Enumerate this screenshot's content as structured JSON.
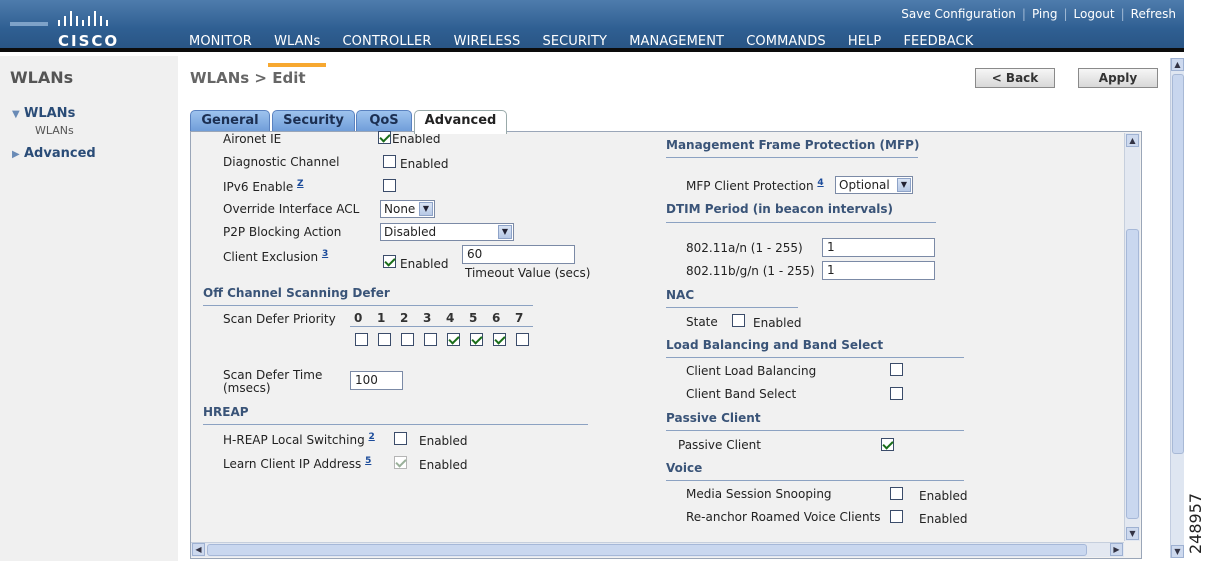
{
  "brand": {
    "logo_text": "CISCO"
  },
  "top_links": [
    "Save Configuration",
    "Ping",
    "Logout",
    "Refresh"
  ],
  "main_nav": [
    "MONITOR",
    "WLANs",
    "CONTROLLER",
    "WIRELESS",
    "SECURITY",
    "MANAGEMENT",
    "COMMANDS",
    "HELP",
    "FEEDBACK"
  ],
  "main_nav_active": "WLANs",
  "sidebar": {
    "title": "WLANs",
    "nodes": [
      {
        "label": "WLANs",
        "expanded": true,
        "children": [
          "WLANs"
        ]
      },
      {
        "label": "Advanced",
        "expanded": false
      }
    ]
  },
  "page": {
    "title": "WLANs > Edit",
    "back_label": "< Back",
    "apply_label": "Apply"
  },
  "tabs": [
    "General",
    "Security",
    "QoS",
    "Advanced"
  ],
  "active_tab": "Advanced",
  "left": {
    "aironet_ie": {
      "label": "Aironet IE",
      "checked": true,
      "text": "Enabled"
    },
    "diagnostic_channel": {
      "label": "Diagnostic Channel",
      "checked": false,
      "text": "Enabled"
    },
    "ipv6_enable": {
      "label": "IPv6 Enable",
      "footnote": "Z",
      "checked": false
    },
    "override_acl": {
      "label": "Override Interface ACL",
      "value": "None"
    },
    "p2p_blocking": {
      "label": "P2P Blocking Action",
      "value": "Disabled"
    },
    "client_exclusion": {
      "label": "Client Exclusion",
      "footnote": "3",
      "checked": true,
      "text": "Enabled",
      "timeout_value": "60",
      "timeout_label": "Timeout Value (secs)"
    },
    "off_channel_section": "Off Channel Scanning Defer",
    "scan_defer_priority": {
      "label": "Scan Defer Priority",
      "priorities": [
        "0",
        "1",
        "2",
        "3",
        "4",
        "5",
        "6",
        "7"
      ],
      "checked": [
        false,
        false,
        false,
        false,
        true,
        true,
        true,
        false
      ]
    },
    "scan_defer_time": {
      "label_line1": "Scan Defer Time",
      "label_line2": "(msecs)",
      "value": "100"
    },
    "hreap_section": "HREAP",
    "hreap_local_switching": {
      "label": "H-REAP Local Switching",
      "footnote": "2",
      "checked": false,
      "text": "Enabled"
    },
    "learn_client_ip": {
      "label": "Learn Client IP Address",
      "footnote": "5",
      "checked": true,
      "disabled": true,
      "text": "Enabled"
    }
  },
  "right": {
    "mfp_section": "Management Frame Protection (MFP)",
    "mfp_client": {
      "label": "MFP Client Protection",
      "footnote": "4",
      "value": "Optional"
    },
    "dtim_section": "DTIM Period (in beacon intervals)",
    "dtim_a": {
      "label": "802.11a/n (1 - 255)",
      "value": "1"
    },
    "dtim_bg": {
      "label": "802.11b/g/n (1 - 255)",
      "value": "1"
    },
    "nac_section": "NAC",
    "nac_state": {
      "label": "State",
      "checked": false,
      "text": "Enabled"
    },
    "lb_section": "Load Balancing and Band Select",
    "client_lb": {
      "label": "Client Load Balancing",
      "checked": false
    },
    "client_bs": {
      "label": "Client Band Select",
      "checked": false
    },
    "passive_section": "Passive Client",
    "passive_client": {
      "label": "Passive Client",
      "checked": true
    },
    "voice_section": "Voice",
    "media_snooping": {
      "label": "Media Session Snooping",
      "checked": false,
      "text": "Enabled"
    },
    "reanchor": {
      "label": "Re-anchor Roamed Voice Clients",
      "checked": false,
      "text": "Enabled"
    }
  },
  "figure_id": "248957",
  "colors": {
    "header": "#2f5f92",
    "nav_active_underline": "#f7a830",
    "section_text": "#3a5478",
    "tab_fill": "#6e9cd8"
  },
  "icons": [
    "cisco-logo-icon",
    "tree-expand-icon",
    "tree-collapse-icon",
    "dropdown-arrow-icon",
    "scroll-up-icon",
    "scroll-down-icon",
    "scroll-left-icon",
    "scroll-right-icon"
  ]
}
